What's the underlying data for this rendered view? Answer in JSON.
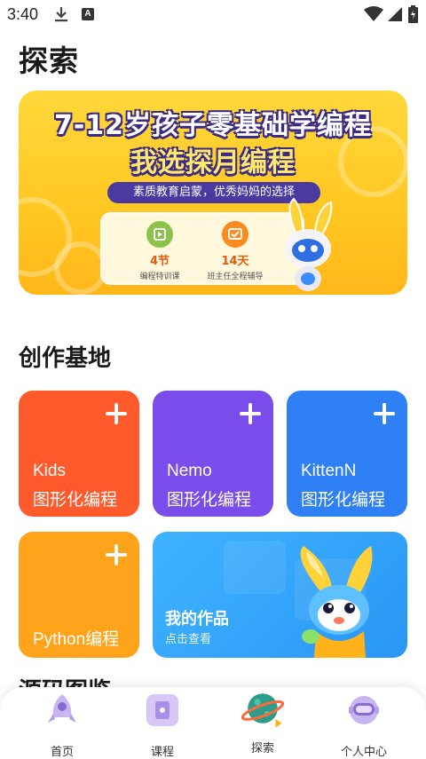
{
  "status_bar": {
    "time": "3:40",
    "badge": "A"
  },
  "page_title": "探索",
  "banner": {
    "headline": "7-12岁孩子零基础学编程",
    "subheadline": "我选探月编程",
    "pill": "素质教育启蒙，优秀妈妈的选择",
    "features": [
      {
        "num": "4节",
        "desc": "编程特训课",
        "icon": "video-icon",
        "color": "#8bc34a"
      },
      {
        "num": "14天",
        "desc": "班主任全程辅导",
        "icon": "tv-icon",
        "color": "#ff8a1e"
      }
    ]
  },
  "section_title": "创作基地",
  "tiles": [
    {
      "name": "Kids",
      "sub": "图形化编程",
      "color": "#ff5a2c"
    },
    {
      "name": "Nemo",
      "sub": "图形化编程",
      "color": "#7a4dea"
    },
    {
      "name": "KittenN",
      "sub": "图形化编程",
      "color": "#2f7ff5"
    },
    {
      "name": "Python编程",
      "color": "#ffa41a"
    }
  ],
  "works": {
    "title": "我的作品",
    "sub": "点击查看"
  },
  "next_section_title": "源码图鉴",
  "nav": [
    {
      "label": "首页",
      "icon": "rocket-icon"
    },
    {
      "label": "课程",
      "icon": "course-icon"
    },
    {
      "label": "探索",
      "icon": "planet-icon",
      "active": true
    },
    {
      "label": "个人中心",
      "icon": "astronaut-icon"
    }
  ]
}
